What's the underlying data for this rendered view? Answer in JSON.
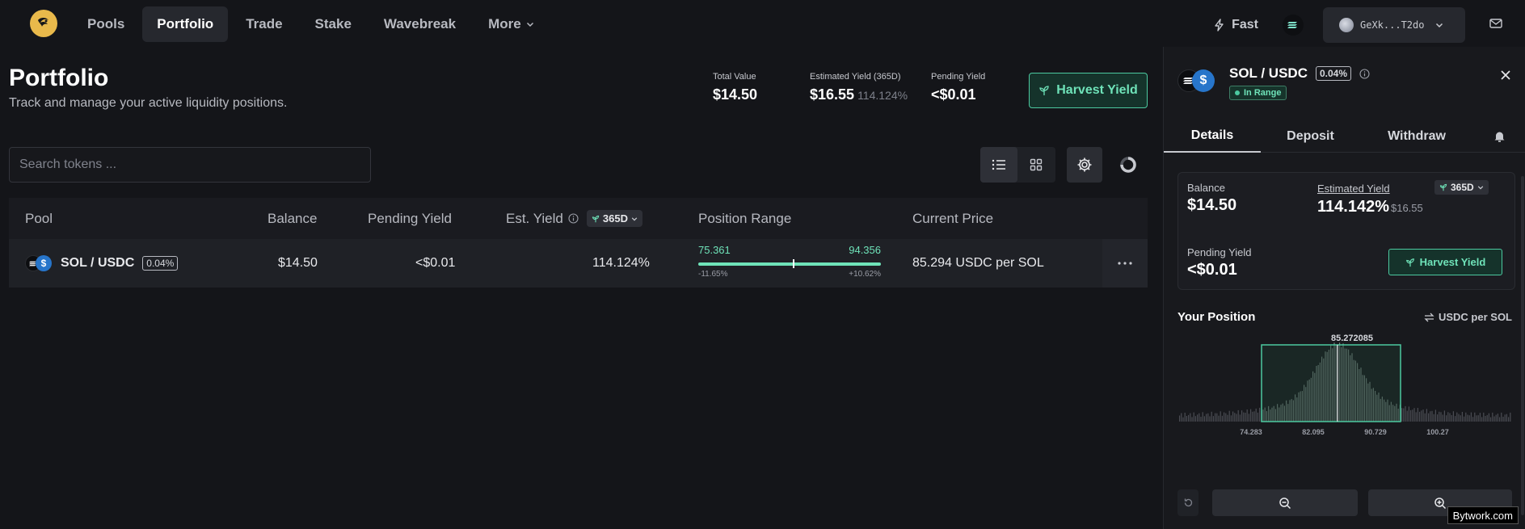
{
  "nav": {
    "items": [
      {
        "label": "Pools",
        "active": false
      },
      {
        "label": "Portfolio",
        "active": true
      },
      {
        "label": "Trade",
        "active": false
      },
      {
        "label": "Stake",
        "active": false
      },
      {
        "label": "Wavebreak",
        "active": false
      },
      {
        "label": "More",
        "active": false
      }
    ],
    "fast_label": "Fast",
    "wallet_address": "GeXk...T2do"
  },
  "header": {
    "title": "Portfolio",
    "subtitle": "Track and manage your active liquidity positions.",
    "total_value_label": "Total Value",
    "total_value": "$14.50",
    "est_yield_label": "Estimated Yield (365D)",
    "est_yield": "$16.55",
    "est_yield_pct": "114.124%",
    "pending_yield_label": "Pending Yield",
    "pending_yield": "<$0.01",
    "harvest_label": "Harvest Yield"
  },
  "search": {
    "placeholder": "Search tokens ..."
  },
  "table": {
    "headers": {
      "pool": "Pool",
      "balance": "Balance",
      "pending": "Pending Yield",
      "est_yield": "Est. Yield",
      "period": "365D",
      "range": "Position Range",
      "price": "Current Price"
    },
    "rows": [
      {
        "pool": "SOL / USDC",
        "fee": "0.04%",
        "balance": "$14.50",
        "pending": "<$0.01",
        "est_yield": "114.124%",
        "range_low": "75.361",
        "range_high": "94.356",
        "range_low_pct": "-11.65%",
        "range_high_pct": "+10.62%",
        "current_position_fraction": 0.52,
        "price": "85.294 USDC per SOL"
      }
    ]
  },
  "panel": {
    "pair": "SOL / USDC",
    "fee": "0.04%",
    "status": "In Range",
    "tabs": [
      "Details",
      "Deposit",
      "Withdraw"
    ],
    "balance_label": "Balance",
    "balance": "$14.50",
    "est_yield_label": "Estimated Yield",
    "period": "365D",
    "est_yield_pct": "114.142%",
    "est_yield_value": "$16.55",
    "pending_label": "Pending Yield",
    "pending": "<$0.01",
    "harvest_label": "Harvest Yield",
    "position_title": "Your Position",
    "unit_label": "USDC per SOL",
    "current_price": "85.272085",
    "axis_ticks": [
      "74.283",
      "82.095",
      "90.729",
      "100.27"
    ]
  },
  "colors": {
    "accent": "#6fe3b9",
    "accent_bg": "#15332b",
    "background": "#141519"
  },
  "watermark": "Bytwork.com"
}
